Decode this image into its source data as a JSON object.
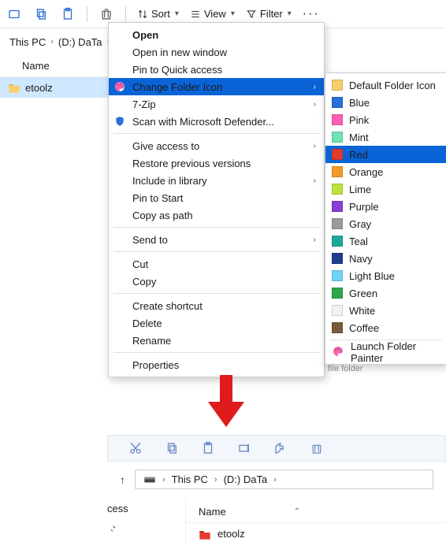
{
  "toolbar": {
    "sort": "Sort",
    "view": "View",
    "filter": "Filter"
  },
  "breadcrumb": {
    "a": "This PC",
    "b": "(D:) DaTa"
  },
  "header": {
    "name_col": "Name"
  },
  "file": {
    "name": "etoolz"
  },
  "ctx": {
    "open": "Open",
    "open_new": "Open in new window",
    "pin_quick": "Pin to Quick access",
    "change_icon": "Change Folder Icon",
    "sevenzip": "7-Zip",
    "defender": "Scan with Microsoft Defender...",
    "give_access": "Give access to",
    "restore": "Restore previous versions",
    "include_lib": "Include in library",
    "pin_start": "Pin to Start",
    "copy_path": "Copy as path",
    "send_to": "Send to",
    "cut": "Cut",
    "copy": "Copy",
    "create_shortcut": "Create shortcut",
    "delete": "Delete",
    "rename": "Rename",
    "properties": "Properties"
  },
  "colors": {
    "default": "Default Folder Icon",
    "blue": "Blue",
    "pink": "Pink",
    "mint": "Mint",
    "red": "Red",
    "orange": "Orange",
    "lime": "Lime",
    "purple": "Purple",
    "gray": "Gray",
    "teal": "Teal",
    "navy": "Navy",
    "lightblue": "Light Blue",
    "green": "Green",
    "white": "White",
    "coffee": "Coffee",
    "launch": "Launch Folder Painter"
  },
  "swatch": {
    "default": "#f7cf6a",
    "blue": "#2a6fd6",
    "pink": "#ff5fb0",
    "mint": "#6fe3b2",
    "red": "#e33b2e",
    "orange": "#f39a2b",
    "lime": "#b9e33a",
    "purple": "#8a3fd6",
    "gray": "#9a9a9a",
    "teal": "#1fa99a",
    "navy": "#1f3d8a",
    "lightblue": "#6fd2f7",
    "green": "#2fa64a",
    "white": "#f2f2f2",
    "coffee": "#7a5a3a"
  },
  "bottom": {
    "crumb_a": "This PC",
    "crumb_b": "(D:) DaTa",
    "side_label": "cess",
    "name_col": "Name",
    "file": "etoolz",
    "truncated_label": "file folder"
  }
}
